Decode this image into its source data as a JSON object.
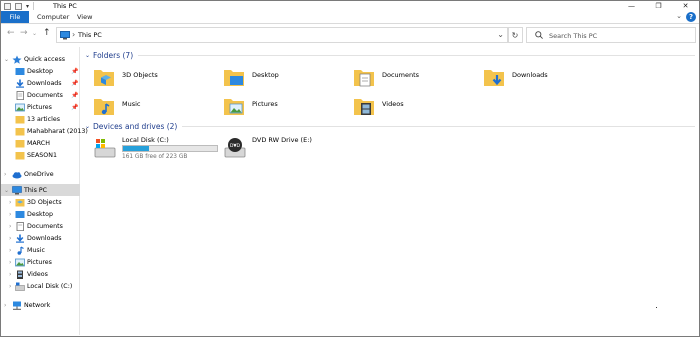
{
  "window": {
    "title": "This PC"
  },
  "ribbon": {
    "tabs": [
      "File",
      "Computer",
      "View"
    ]
  },
  "address": {
    "location": "This PC"
  },
  "search": {
    "placeholder": "Search This PC"
  },
  "nav": {
    "quick_access": "Quick access",
    "quick_items": [
      "Desktop",
      "Downloads",
      "Documents",
      "Pictures",
      "13 articles",
      "Mahabharat (2013)",
      "MARCH",
      "SEASON1"
    ],
    "onedrive": "OneDrive",
    "this_pc": "This PC",
    "pc_items": [
      "3D Objects",
      "Desktop",
      "Documents",
      "Downloads",
      "Music",
      "Pictures",
      "Videos",
      "Local Disk (C:)"
    ],
    "network": "Network"
  },
  "folders": {
    "heading": "Folders (7)",
    "items": [
      "3D Objects",
      "Desktop",
      "Documents",
      "Downloads",
      "Music",
      "Pictures",
      "Videos"
    ]
  },
  "drives": {
    "heading": "Devices and drives (2)",
    "local_disk": {
      "name": "Local Disk (C:)",
      "free_text": "161 GB free of 223 GB",
      "used_fraction": 0.278
    },
    "dvd": {
      "name": "DVD RW Drive (E:)",
      "label": "DVD"
    }
  },
  "colors": {
    "accent": "#1a6fc9",
    "group_heading": "#1e3c8c",
    "usage_bar": "#26a0da",
    "selection": "#d9d9d9",
    "folder": "#f3c34c"
  }
}
